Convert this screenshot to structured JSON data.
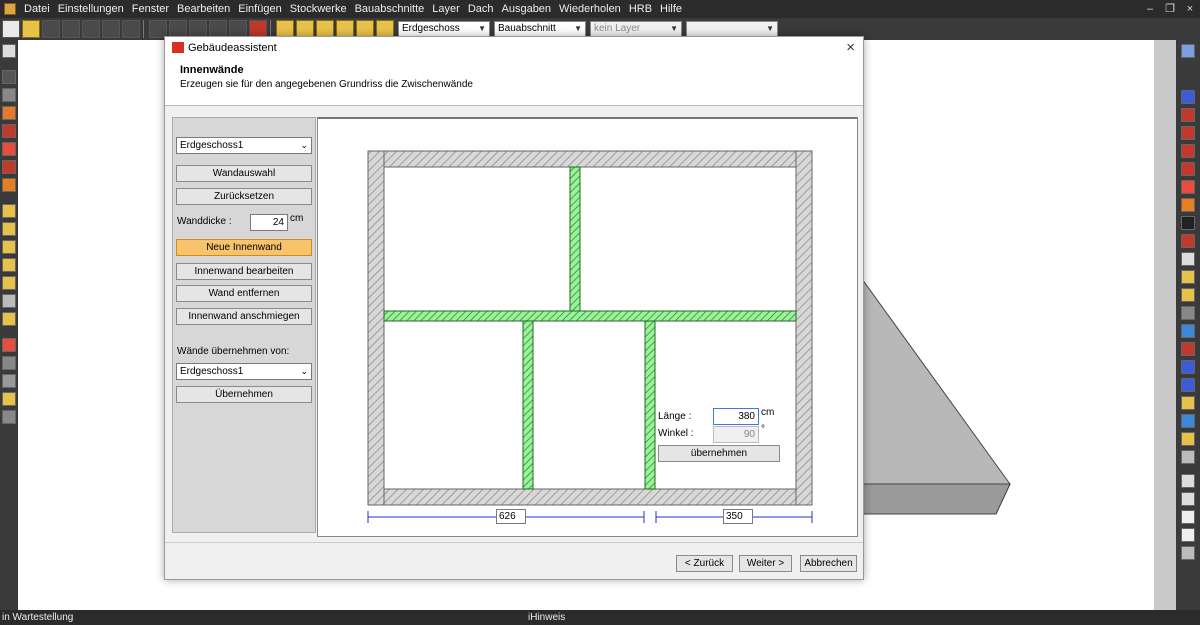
{
  "menubar": {
    "items": [
      "Datei",
      "Einstellungen",
      "Fenster",
      "Bearbeiten",
      "Einfügen",
      "Stockwerke",
      "Bauabschnitte",
      "Layer",
      "Dach",
      "Ausgaben",
      "Wiederholen",
      "HRB",
      "Hilfe"
    ],
    "window_controls": [
      "–",
      "❐",
      "×"
    ]
  },
  "toolbar": {
    "combo_floor": "Erdgeschoss",
    "combo_section": "Bauabschnitt",
    "combo_layer": "kein Layer",
    "combo_empty": ""
  },
  "statusbar": {
    "left": "in Wartestellung",
    "hint": "iHinweis"
  },
  "dialog": {
    "title": "Gebäudeassistent",
    "header_title": "Innenwände",
    "header_subtitle": "Erzeugen sie für den angegebenen Grundriss die Zwischenwände",
    "floor_select": "Erdgeschoss1",
    "btn_wandauswahl": "Wandauswahl",
    "btn_reset": "Zurücksetzen",
    "wall_thickness_label": "Wanddicke :",
    "wall_thickness_value": "24",
    "wall_thickness_unit": "cm",
    "btn_new_wall": "Neue Innenwand",
    "btn_edit_wall": "Innenwand bearbeiten",
    "btn_remove_wall": "Wand entfernen",
    "btn_snap_wall": "Innenwand anschmiegen",
    "take_from_label": "Wände übernehmen von:",
    "take_from_select": "Erdgeschoss1",
    "btn_take_over": "Übernehmen",
    "length_label": "Länge :",
    "length_value": "380",
    "length_unit": "cm",
    "angle_label": "Winkel :",
    "angle_value": "90",
    "angle_unit": "°",
    "btn_apply": "übernehmen",
    "dim_left": "626",
    "dim_right": "350",
    "btn_back": "< Zurück",
    "btn_next": "Weiter >",
    "btn_cancel": "Abbrechen"
  }
}
